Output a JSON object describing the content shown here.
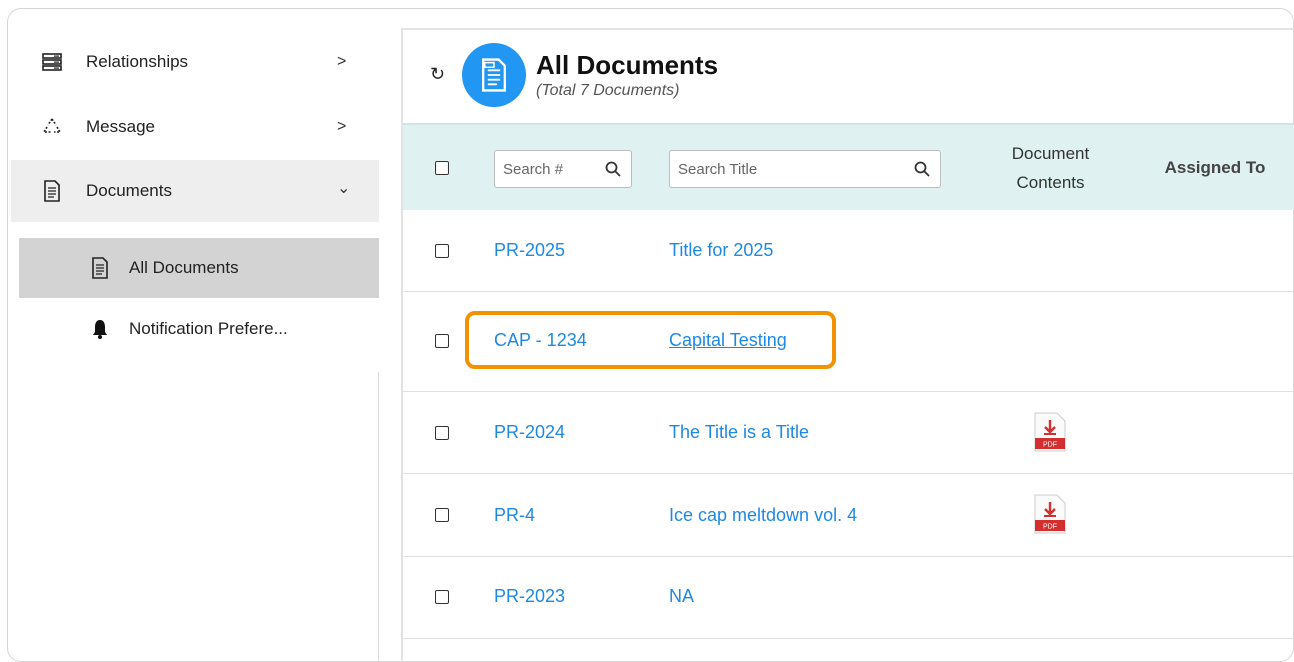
{
  "sidebar": {
    "items": [
      {
        "label": "Relationships",
        "chevron": ">",
        "icon": "server-stack-icon"
      },
      {
        "label": "Message",
        "chevron": ">",
        "icon": "recycle-icon"
      },
      {
        "label": "Documents",
        "chevron": "⌄",
        "icon": "document-icon"
      }
    ],
    "sub_items": [
      {
        "label": "All Documents",
        "icon": "document-icon",
        "selected": true
      },
      {
        "label": "Notification Prefere...",
        "icon": "bell-icon",
        "selected": false
      }
    ]
  },
  "header": {
    "title": "All Documents",
    "subtitle": "(Total 7 Documents)",
    "refresh_icon": "↻"
  },
  "table": {
    "search_number_placeholder": "Search #",
    "search_title_placeholder": "Search Title",
    "col_contents": "Document Contents",
    "col_assigned": "Assigned To",
    "rows": [
      {
        "number": "PR-2025",
        "title": "Title for 2025",
        "has_pdf": false
      },
      {
        "number": "CAP - 1234",
        "title": "Capital Testing",
        "has_pdf": false
      },
      {
        "number": "PR-2024",
        "title": "The Title is a Title",
        "has_pdf": true
      },
      {
        "number": "PR-4",
        "title": "Ice cap meltdown vol. 4",
        "has_pdf": true
      },
      {
        "number": "PR-2023",
        "title": "NA",
        "has_pdf": false
      }
    ],
    "pdf_label": "PDF"
  },
  "colors": {
    "accent": "#2196f3",
    "link": "#1e88e5",
    "header_bg": "#dff1f1",
    "highlight": "#f39200",
    "pdf_red": "#d32f2f"
  }
}
